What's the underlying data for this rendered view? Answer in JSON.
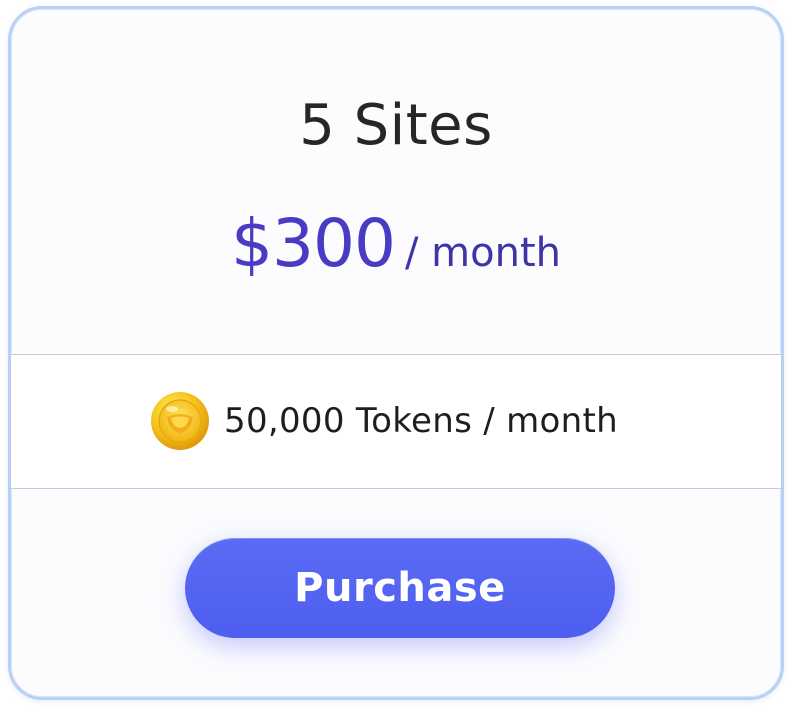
{
  "plan": {
    "title": "5 Sites",
    "price": "$300",
    "period": "/ month"
  },
  "tokens": {
    "icon": "coin-icon",
    "label": "50,000 Tokens / month"
  },
  "actions": {
    "purchase_label": "Purchase"
  },
  "colors": {
    "accent": "#4d5ef0",
    "price": "#4a3cc2",
    "card_border": "#b9d0f5",
    "coin": "#f5c518"
  }
}
